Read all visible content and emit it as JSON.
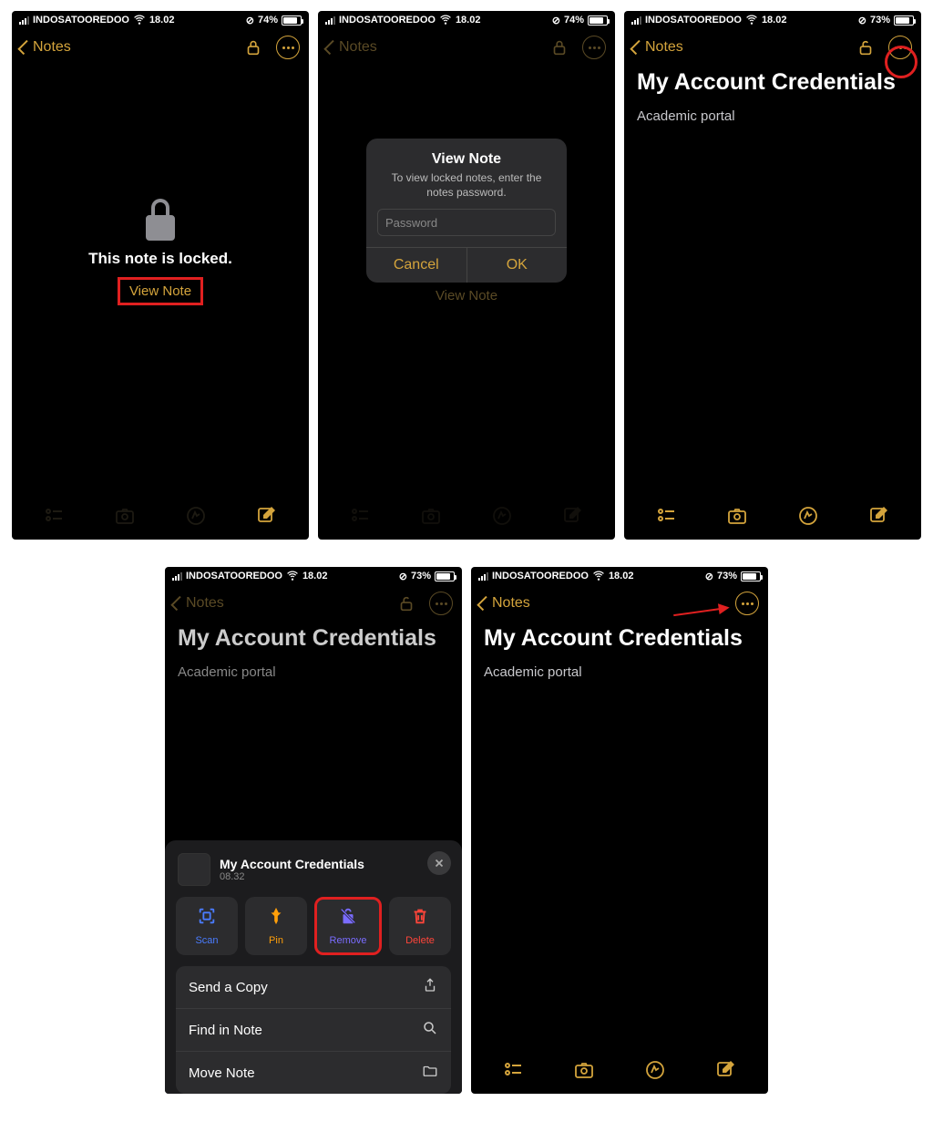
{
  "status": {
    "carrier": "INDOSATOOREDOO",
    "time": "18.02",
    "battery74": "74%",
    "battery73": "73%"
  },
  "nav": {
    "back": "Notes"
  },
  "locked": {
    "text": "This note is locked.",
    "view": "View Note"
  },
  "alert": {
    "title": "View Note",
    "msg": "To view locked notes, enter the notes password.",
    "placeholder": "Password",
    "cancel": "Cancel",
    "ok": "OK"
  },
  "note": {
    "title": "My Account Credentials",
    "body": "Academic portal"
  },
  "sheet": {
    "title": "My Account Credentials",
    "time": "08.32",
    "scan": "Scan",
    "pin": "Pin",
    "remove": "Remove",
    "delete": "Delete",
    "send": "Send a Copy",
    "find": "Find in Note",
    "move": "Move Note"
  }
}
